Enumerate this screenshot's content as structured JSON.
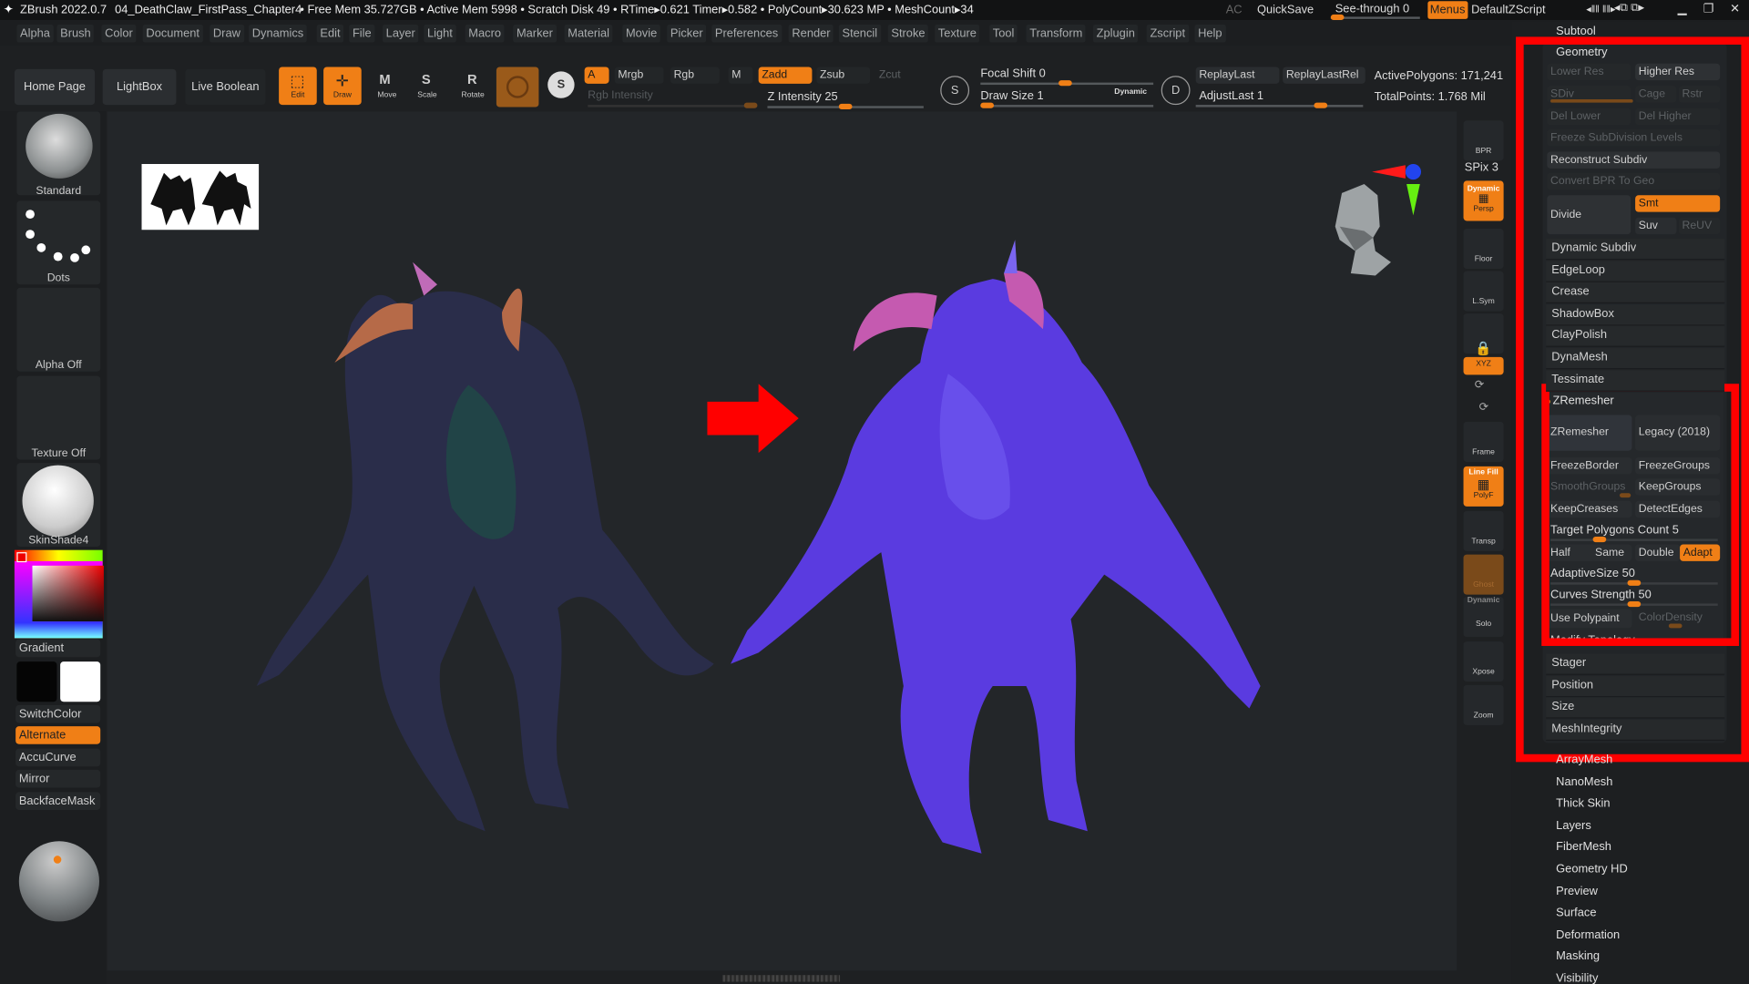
{
  "titlebar": {
    "app": "ZBrush 2022.0.7",
    "file": "04_DeathClaw_FirstPass_Chapter4",
    "stats": "• Free Mem 35.727GB • Active Mem 5998 • Scratch Disk 49 •  RTime▸0.621 Timer▸0.582 • PolyCount▸30.623 MP  • MeshCount▸34",
    "ac": "AC",
    "quicksave": "QuickSave",
    "seethrough": "See-through  0",
    "seethrough_value": 0,
    "menus": "Menus",
    "script": "DefaultZScript"
  },
  "menus": [
    "Alpha",
    "Brush",
    "Color",
    "Document",
    "Draw",
    "Dynamics",
    "Edit",
    "File",
    "Layer",
    "Light",
    "Macro",
    "Marker",
    "Material",
    "Movie",
    "Picker",
    "Preferences",
    "Render",
    "Stencil",
    "Stroke",
    "Texture",
    "Tool",
    "Transform",
    "Zplugin",
    "Zscript",
    "Help"
  ],
  "toolbar": {
    "home": "Home Page",
    "lightbox": "LightBox",
    "liveboolean": "Live Boolean",
    "edit": "Edit",
    "draw": "Draw",
    "move": "Move",
    "scale": "Scale",
    "rotate": "Rotate",
    "a": "A",
    "mrgb": "Mrgb",
    "rgb": "Rgb",
    "m": "M",
    "zadd": "Zadd",
    "zsub": "Zsub",
    "zcut": "Zcut",
    "rgb_intensity": "Rgb Intensity",
    "z_intensity": "Z Intensity 25",
    "focal_shift": "Focal Shift 0",
    "draw_size": "Draw Size 1",
    "dynamic": "Dynamic",
    "replaylast": "ReplayLast",
    "replaylastrel": "ReplayLastRel",
    "adjustlast": "AdjustLast 1",
    "active_polygons": "ActivePolygons: 171,241",
    "total_points": "TotalPoints: 1.768 Mil",
    "s": "S",
    "d": "D"
  },
  "left": {
    "brush": "Standard",
    "stroke": "Dots",
    "alpha": "Alpha Off",
    "texture": "Texture Off",
    "material": "SkinShade4",
    "gradient": "Gradient",
    "switchcolor": "SwitchColor",
    "alternate": "Alternate",
    "accucurve": "AccuCurve",
    "mirror": "Mirror",
    "backfacemask": "BackfaceMask"
  },
  "shelf": {
    "bpr": "BPR",
    "spix": "SPix 3",
    "persp_top": "Dynamic",
    "persp": "Persp",
    "floor": "Floor",
    "lsym": "L.Sym",
    "xyz": "XYZ",
    "frame": "Frame",
    "polyf_top": "Line Fill",
    "polyf": "PolyF",
    "transp": "Transp",
    "ghost": "Ghost",
    "solo_top": "Dynamic",
    "solo": "Solo",
    "xpose": "Xpose",
    "zoom": "Zoom"
  },
  "panel": {
    "subtool": "Subtool",
    "geometry": "Geometry",
    "lower_res": "Lower Res",
    "higher_res": "Higher Res",
    "sdiv": "SDiv",
    "cage": "Cage",
    "rstr": "Rstr",
    "del_lower": "Del Lower",
    "del_higher": "Del Higher",
    "freeze": "Freeze SubDivision Levels",
    "reconstruct": "Reconstruct Subdiv",
    "convert": "Convert BPR To Geo",
    "divide": "Divide",
    "smt": "Smt",
    "suv": "Suv",
    "reuv": "ReUV",
    "items": [
      "Dynamic Subdiv",
      "EdgeLoop",
      "Crease",
      "ShadowBox",
      "ClayPolish",
      "DynaMesh",
      "Tessimate"
    ],
    "zremesher": {
      "header": "ZRemesher",
      "zremesher": "ZRemesher",
      "legacy": "Legacy (2018)",
      "freezeborder": "FreezeBorder",
      "freezegroups": "FreezeGroups",
      "smoothgroups": "SmoothGroups",
      "keepgroups": "KeepGroups",
      "keepcreases": "KeepCreases",
      "detectedges": "DetectEdges",
      "target": "Target Polygons Count 5",
      "target_value": 5,
      "half": "Half",
      "same": "Same",
      "double": "Double",
      "adapt": "Adapt",
      "adaptivesize": "AdaptiveSize 50",
      "adaptivesize_value": 50,
      "curves": "Curves Strength 50",
      "curves_value": 50,
      "polypaint": "Use Polypaint",
      "colordensity": "ColorDensity",
      "modify": "Modify Topology"
    },
    "items2": [
      "Stager",
      "Position",
      "Size",
      "MeshIntegrity"
    ],
    "below": [
      "ArrayMesh",
      "NanoMesh",
      "Thick Skin",
      "Layers",
      "FiberMesh",
      "Geometry HD",
      "Preview",
      "Surface",
      "Deformation",
      "Masking",
      "Visibility"
    ]
  },
  "colors": {
    "accent": "#f07f16",
    "highlight": "#ff0000",
    "mesh": "#6a45e6"
  }
}
